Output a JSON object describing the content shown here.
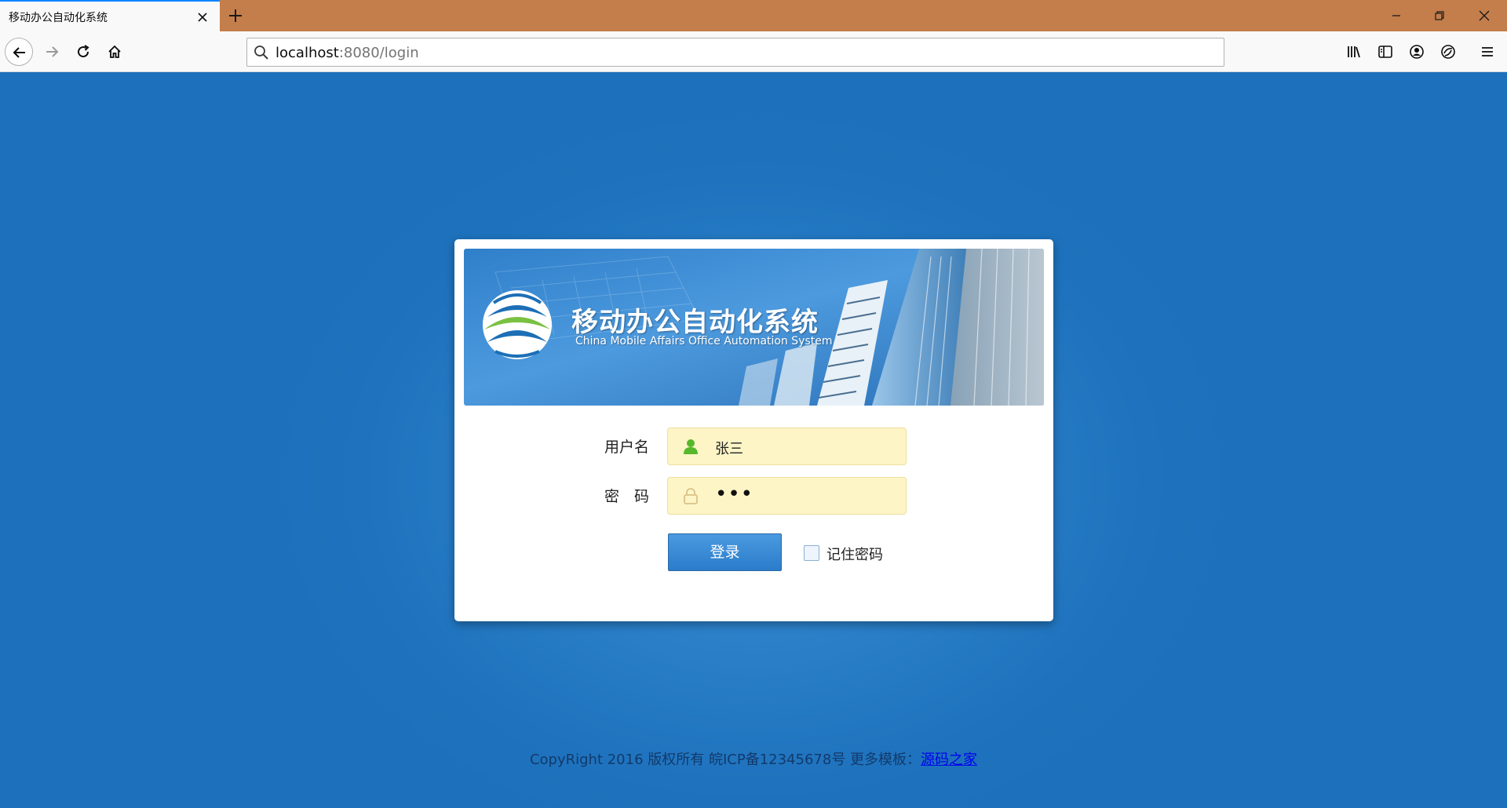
{
  "browser": {
    "tab_title": "移动办公自动化系统",
    "url_host": "localhost",
    "url_path": ":8080/login"
  },
  "banner": {
    "title": "移动办公自动化系统",
    "subtitle": "China Mobile Affairs Office Automation System"
  },
  "form": {
    "username_label": "用户名",
    "username_value": "张三",
    "password_label": "密　码",
    "password_mask": "•••",
    "login_button": "登录",
    "remember_label": "记住密码",
    "remember_checked": false
  },
  "footer": {
    "text": "CopyRight 2016  版权所有  皖ICP备12345678号 更多模板：",
    "link_text": "源码之家"
  },
  "colors": {
    "page_background": "#1f73be",
    "tabbar": "#c47e4b",
    "field_background": "#fdf5c6",
    "button": "#2b7cca"
  }
}
